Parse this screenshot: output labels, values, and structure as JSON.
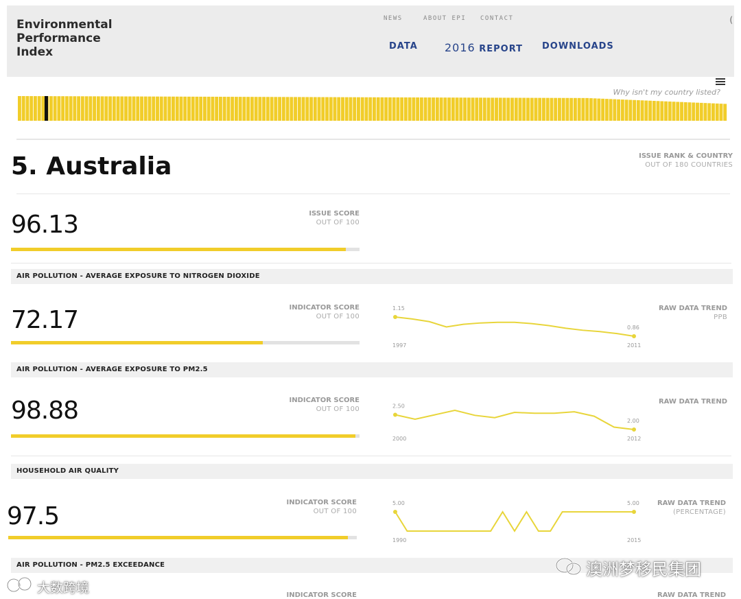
{
  "header": {
    "logo_line1": "Environmental",
    "logo_line2": "Performance",
    "logo_line3": "Index",
    "topnav": [
      "NEWS",
      "ABOUT EPI",
      "CONTACT"
    ],
    "mainnav": [
      "DATA",
      "2016",
      "REPORT",
      "DOWNLOADS"
    ],
    "edge_glyph": "("
  },
  "why_link": "Why isn't my country listed?",
  "rank_strip": {
    "total": 180,
    "selected_rank": 5,
    "color": "#f1cd2a",
    "marker_color": "#111111"
  },
  "country": {
    "title": "5. Australia",
    "rank_label": "ISSUE RANK & COUNTRY",
    "rank_sub": "OUT OF 180 COUNTRIES"
  },
  "issue": {
    "score": "96.13",
    "score_value": 96.13,
    "label": "ISSUE SCORE",
    "sub": "OUT OF 100"
  },
  "indicators": [
    {
      "title": "AIR POLLUTION - AVERAGE EXPOSURE TO NITROGEN DIOXIDE",
      "score": "72.17",
      "score_value": 72.17,
      "label": "INDICATOR SCORE",
      "sub": "OUT OF 100",
      "trend_label": "RAW DATA TREND",
      "trend_sub": "PPB",
      "start_value": "1.15",
      "end_value": "0.86",
      "start_year": "1997",
      "end_year": "2011",
      "points": [
        1.15,
        1.12,
        1.08,
        1.0,
        1.04,
        1.06,
        1.07,
        1.07,
        1.05,
        1.02,
        0.98,
        0.95,
        0.93,
        0.9,
        0.86
      ]
    },
    {
      "title": "AIR POLLUTION - AVERAGE EXPOSURE TO PM2.5",
      "score": "98.88",
      "score_value": 98.88,
      "label": "INDICATOR SCORE",
      "sub": "OUT OF 100",
      "trend_label": "RAW DATA TREND",
      "trend_sub": "",
      "start_value": "2.50",
      "end_value": "2.00",
      "start_year": "2000",
      "end_year": "2012",
      "points": [
        2.5,
        2.35,
        2.5,
        2.65,
        2.48,
        2.4,
        2.58,
        2.55,
        2.55,
        2.6,
        2.45,
        2.08,
        2.0
      ]
    },
    {
      "title": "HOUSEHOLD AIR QUALITY",
      "score": "97.5",
      "score_value": 97.5,
      "label": "INDICATOR SCORE",
      "sub": "OUT OF 100",
      "trend_label": "RAW DATA TREND",
      "trend_sub": "(PERCENTAGE)",
      "start_value": "5.00",
      "end_value": "5.00",
      "start_year": "1990",
      "end_year": "2015",
      "points": [
        5.0,
        2.5,
        2.5,
        2.5,
        2.5,
        2.5,
        2.5,
        2.5,
        2.5,
        5.0,
        2.5,
        5.0,
        2.5,
        2.5,
        5.0,
        5.0,
        5.0,
        5.0,
        5.0,
        5.0,
        5.0
      ]
    },
    {
      "title": "AIR POLLUTION - PM2.5 EXCEEDANCE",
      "label": "INDICATOR SCORE",
      "trend_label": "RAW DATA TREND"
    }
  ],
  "watermarks": {
    "right": "澳洲梦移民集团",
    "left": "大数跨境"
  },
  "colors": {
    "accent": "#f1cd2a",
    "nav": "#27448a"
  }
}
